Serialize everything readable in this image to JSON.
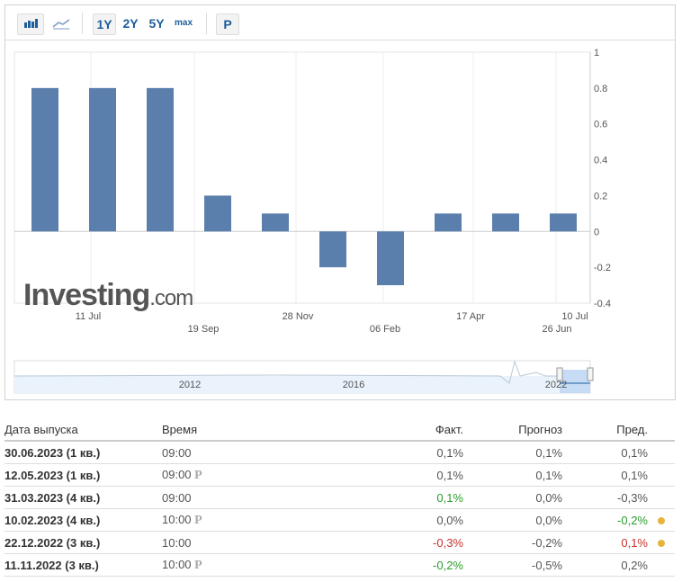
{
  "toolbar": {
    "bar_icon": "bar-chart-icon",
    "line_icon": "line-chart-icon",
    "ranges": [
      "1Y",
      "2Y",
      "5Y",
      "max"
    ],
    "selected_range": "1Y",
    "p_label": "P"
  },
  "logo": "Investing.com",
  "chart_data": {
    "type": "bar",
    "values": [
      0.8,
      0.8,
      0.8,
      0.2,
      0.1,
      -0.2,
      -0.3,
      0.1,
      0.1,
      0.1
    ],
    "ylim": [
      -0.4,
      1
    ],
    "yticks": [
      "1",
      "0.8",
      "0.6",
      "0.4",
      "0.2",
      "0",
      "-0.2",
      "-0.4"
    ],
    "xticks": [
      "11 Jul",
      "19 Sep",
      "28 Nov",
      "06 Feb",
      "17 Apr",
      "10 Jul",
      "26 Jun"
    ],
    "bar_color": "#5b7fad",
    "grid": true
  },
  "navigator": {
    "labels": [
      "2012",
      "2016",
      "2022"
    ]
  },
  "table": {
    "headers": [
      "Дата выпуска",
      "Время",
      "Факт.",
      "Прогноз",
      "Пред."
    ],
    "rows": [
      {
        "date": "30.06.2023 (1 кв.)",
        "time": "09:00",
        "p": false,
        "actual": "0,1%",
        "actual_c": "",
        "forecast": "0,1%",
        "prev": "0,1%",
        "prev_c": "",
        "dot": false
      },
      {
        "date": "12.05.2023 (1 кв.)",
        "time": "09:00",
        "p": true,
        "actual": "0,1%",
        "actual_c": "",
        "forecast": "0,1%",
        "prev": "0,1%",
        "prev_c": "",
        "dot": false
      },
      {
        "date": "31.03.2023 (4 кв.)",
        "time": "09:00",
        "p": false,
        "actual": "0,1%",
        "actual_c": "pos",
        "forecast": "0,0%",
        "prev": "-0,3%",
        "prev_c": "",
        "dot": false
      },
      {
        "date": "10.02.2023 (4 кв.)",
        "time": "10:00",
        "p": true,
        "actual": "0,0%",
        "actual_c": "",
        "forecast": "0,0%",
        "prev": "-0,2%",
        "prev_c": "pos",
        "dot": true
      },
      {
        "date": "22.12.2022 (3 кв.)",
        "time": "10:00",
        "p": false,
        "actual": "-0,3%",
        "actual_c": "neg",
        "forecast": "-0,2%",
        "prev": "0,1%",
        "prev_c": "neg",
        "dot": true
      },
      {
        "date": "11.11.2022 (3 кв.)",
        "time": "10:00",
        "p": true,
        "actual": "-0,2%",
        "actual_c": "pos",
        "forecast": "-0,5%",
        "prev": "0,2%",
        "prev_c": "",
        "dot": false
      }
    ]
  }
}
